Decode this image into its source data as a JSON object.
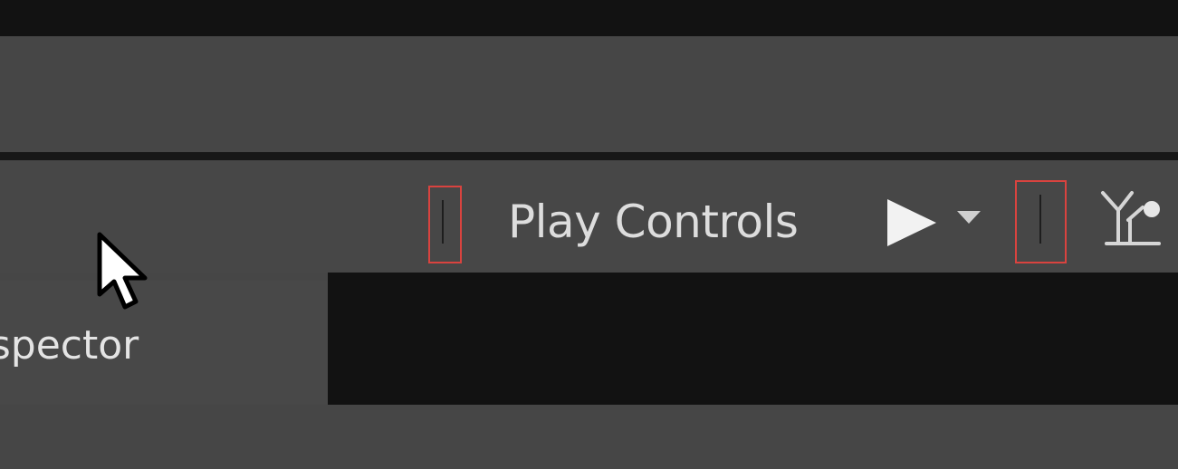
{
  "toolbar": {
    "play_controls_label": "Play Controls",
    "play_icon": "play-icon",
    "dropdown_icon": "caret-down-icon",
    "remote_icon": "remote-network-icon"
  },
  "dock": {
    "inspector_tab_label": "Inspector"
  },
  "colors": {
    "background": "#474747",
    "dark_strip": "#121212",
    "highlight": "#d9433f",
    "text": "#dddddd"
  }
}
